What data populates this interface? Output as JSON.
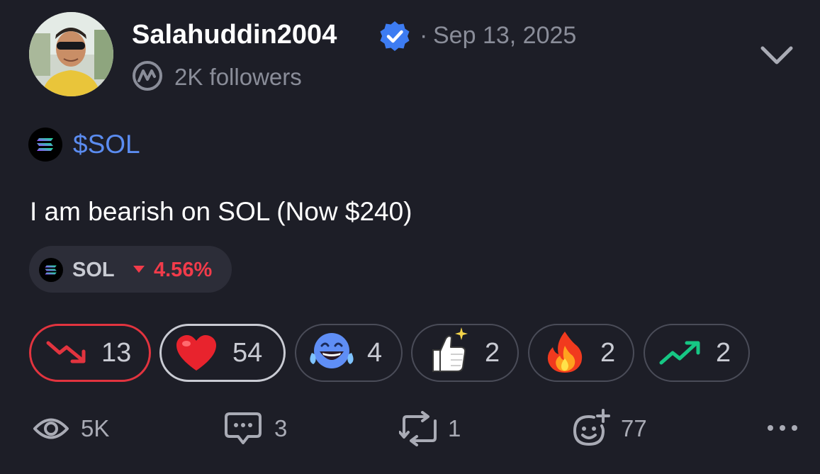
{
  "author": {
    "username": "Salahuddin2004",
    "dot": "·",
    "date": "Sep 13, 2025",
    "followers": "2K followers",
    "verified_icon": "verified-badge-icon",
    "platform_icon": "coinmarketcap-icon"
  },
  "post": {
    "cashtag": "$SOL",
    "text": "I am bearish on SOL (Now $240)"
  },
  "ticker": {
    "symbol": "SOL",
    "change": "4.56%",
    "direction": "down",
    "change_color": "#f23b4a"
  },
  "reactions": [
    {
      "name": "bearish",
      "icon": "trend-down-icon",
      "count": "13",
      "selected": true
    },
    {
      "name": "heart",
      "icon": "heart-icon",
      "count": "54",
      "selected": true
    },
    {
      "name": "laugh",
      "icon": "laughing-face-icon",
      "count": "4",
      "selected": false
    },
    {
      "name": "thumbs-up",
      "icon": "thumbs-up-icon",
      "count": "2",
      "selected": false
    },
    {
      "name": "fire",
      "icon": "fire-icon",
      "count": "2",
      "selected": false
    },
    {
      "name": "bullish",
      "icon": "trend-up-icon",
      "count": "2",
      "selected": false
    }
  ],
  "stats": {
    "views": "5K",
    "comments": "3",
    "reposts": "1",
    "reactions": "77"
  },
  "colors": {
    "background": "#1d1e27",
    "accent_blue": "#5b8cf0",
    "bearish_red": "#e2343f",
    "bullish_green": "#16c784",
    "muted_text": "#8a8d99"
  }
}
